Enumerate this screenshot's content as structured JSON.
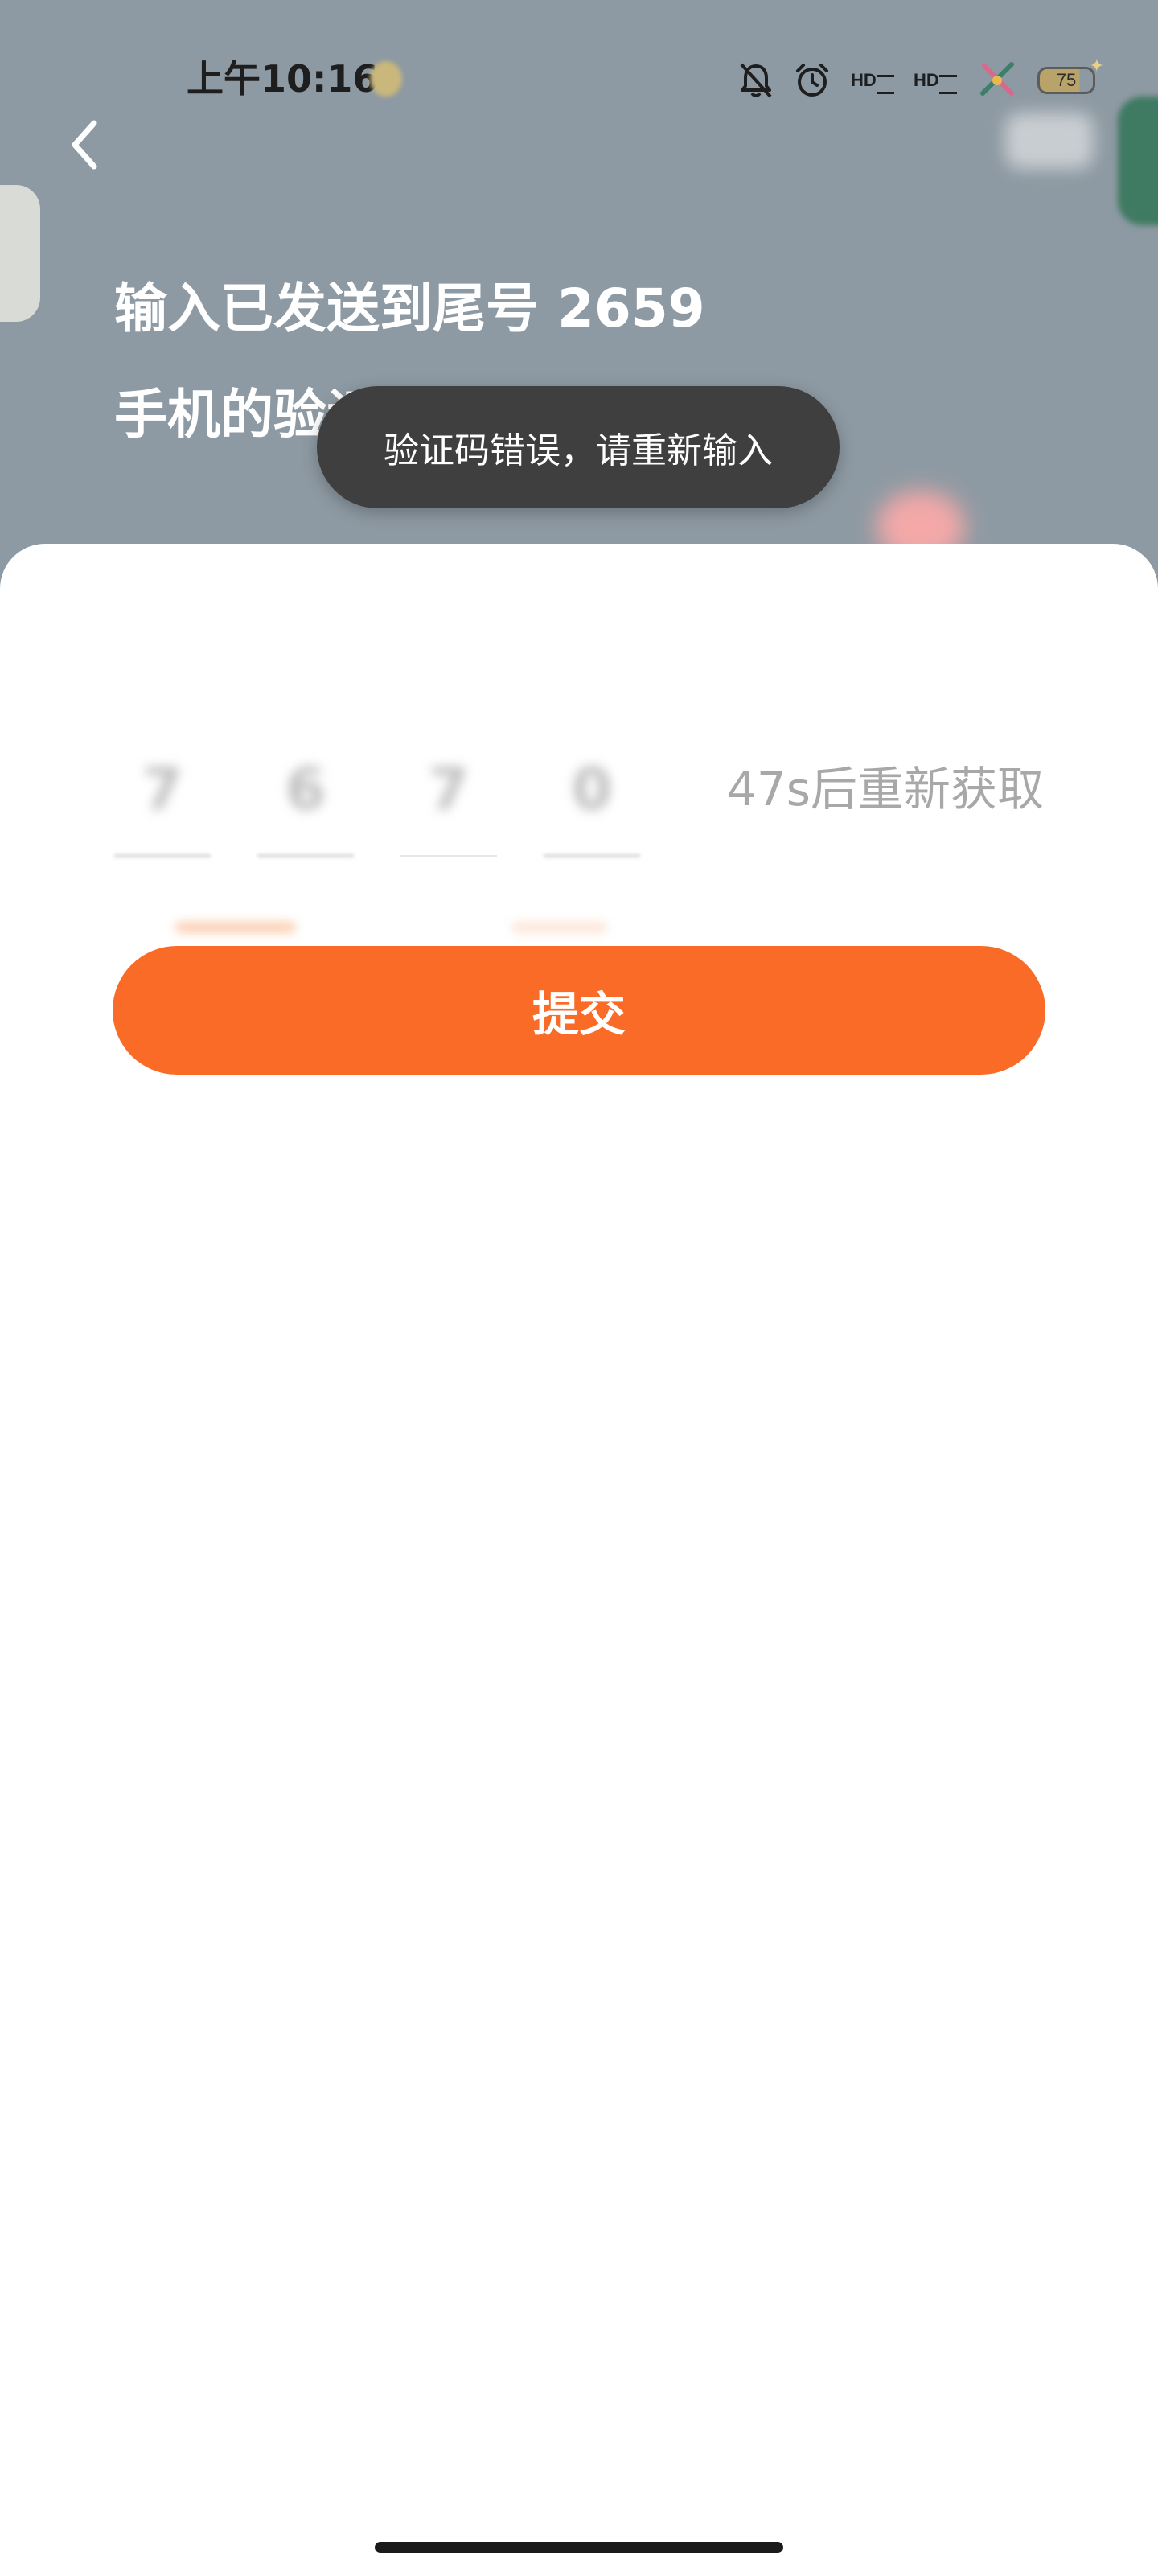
{
  "status_bar": {
    "time": "上午10:16",
    "battery_level": "75",
    "icons": [
      "weather-icon",
      "bell-muted-icon",
      "alarm-icon",
      "hd-signal-icon",
      "hd-signal-icon",
      "app-notification-icon",
      "battery-icon"
    ],
    "hd_label": "HD"
  },
  "header": {
    "back_icon": "chevron-left-icon",
    "title_line1": "输入已发送到尾号 2659",
    "title_line2": "手机的验证码"
  },
  "toast": {
    "message": "验证码错误，请重新输入"
  },
  "verification": {
    "digits": [
      "7",
      "6",
      "7",
      "0"
    ],
    "resend_label": "47s后重新获取"
  },
  "actions": {
    "submit_label": "提交"
  },
  "colors": {
    "header_bg": "#8E9AA3",
    "accent": "#FA6B28",
    "toast_bg": "#3F3F3F",
    "muted_text": "#A8A8A8"
  }
}
